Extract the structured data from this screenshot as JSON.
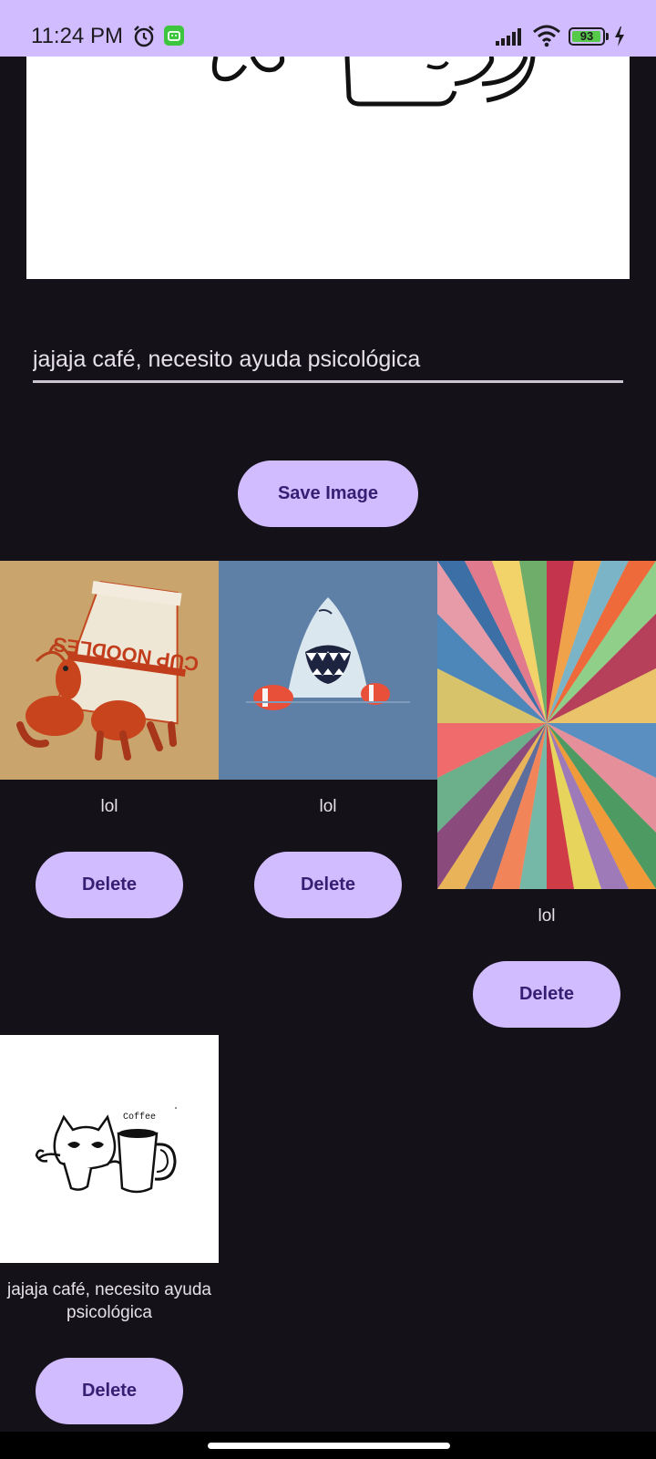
{
  "status_bar": {
    "time": "11:24 PM",
    "battery_level": "93",
    "icons": [
      "alarm-icon",
      "app-notification-icon",
      "signal-icon",
      "wifi-icon",
      "battery-icon",
      "charging-icon"
    ]
  },
  "editor": {
    "caption_value": "jajaja café, necesito ayuda psicológica",
    "save_label": "Save Image"
  },
  "gallery": {
    "items": [
      {
        "image": "hermit-crab-cup-noodles",
        "image_text": "CUP NOODLES",
        "caption": "lol",
        "delete_label": "Delete"
      },
      {
        "image": "shark-with-floaties",
        "caption": "lol",
        "delete_label": "Delete"
      },
      {
        "image": "rainbow-burst-rays",
        "caption": "lol",
        "delete_label": "Delete"
      },
      {
        "image": "cat-holding-coffee-mug",
        "image_text": "Coffee",
        "caption": "jajaja café, necesito ayuda psicológica",
        "delete_label": "Delete"
      }
    ]
  },
  "colors": {
    "background": "#141218",
    "accent": "#d0bcff",
    "on_accent": "#381e72",
    "text": "#e6e0e9"
  }
}
